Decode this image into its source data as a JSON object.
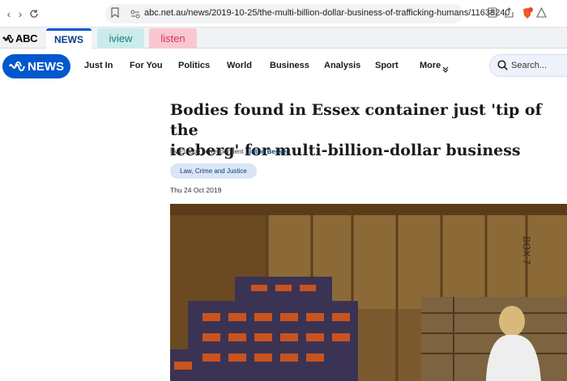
{
  "browser": {
    "url": "abc.net.au/news/2019-10-25/the-multi-billion-dollar-business-of-trafficking-humans/11638240"
  },
  "network": {
    "logo": "ABC",
    "tabs": [
      {
        "label": "NEWS"
      },
      {
        "label": "iview"
      },
      {
        "label": "listen"
      }
    ]
  },
  "header": {
    "logo_text": "NEWS",
    "menu": [
      {
        "label": "Just In"
      },
      {
        "label": "For You"
      },
      {
        "label": "Politics"
      },
      {
        "label": "World"
      },
      {
        "label": "Business"
      },
      {
        "label": "Analysis"
      },
      {
        "label": "Sport"
      },
      {
        "label": "More"
      }
    ],
    "search_placeholder": "Search..."
  },
  "article": {
    "title_line1": "Bodies found in Essex container just 'tip of the",
    "title_line2": "iceberg' for multi-billion-dollar business",
    "byline_prefix": "By Europe correspondent",
    "byline_author": "Linton Besser",
    "topic": "Law, Crime and Justice",
    "date": "Thu 24 Oct 2019",
    "image_box_text": "BOX 7"
  },
  "colors": {
    "brand_blue": "#0058cc",
    "iview_bg": "#c9eceb",
    "listen_bg": "#f9c7d0",
    "pill_bg": "#dbe6f5"
  }
}
